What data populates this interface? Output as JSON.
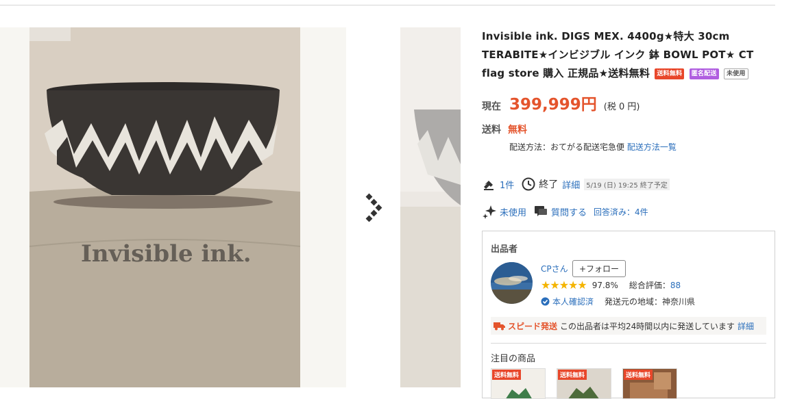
{
  "product": {
    "title": "Invisible ink. DIGS MEX. 4400g★特大 30cm TERABITE★インビジブル インク 鉢 BOWL POT★ CT flag store 購入 正規品★送料無料",
    "tags": {
      "free_shipping": "送料無料",
      "anonymous": "匿名配送",
      "unused": "未使用"
    },
    "price_label": "現在",
    "price": "399,999円",
    "tax": "(税 0 円)",
    "shipping_label": "送料",
    "shipping_value": "無料",
    "shipping_method_prefix": "配送方法：おてがる配送宅急便",
    "shipping_method_link": "配送方法一覧",
    "bids": "1件",
    "status": "終了",
    "details_link": "詳細",
    "end_time": "5/19 (日) 19:25 終了予定",
    "condition": "未使用",
    "ask_question": "質問する",
    "answered": "回答済み：4件",
    "photo_text": "Invisible ink."
  },
  "seller": {
    "heading": "出品者",
    "name": "CPさん",
    "follow_label": "+フォロー",
    "rating_percent": "97.8%",
    "total_label": "総合評価：",
    "total_value": "88",
    "verified": "本人確認済",
    "region": "発送元の地域：神奈川県",
    "speed_label": "スピード発送",
    "speed_text": "この出品者は平均24時間以内に発送しています",
    "speed_link": "詳細",
    "featured_heading": "注目の商品",
    "featured_tag": "送料無料",
    "stars": 5
  },
  "colors": {
    "accent": "#e4542c",
    "link": "#2a6ebb",
    "star": "#f4b400"
  }
}
